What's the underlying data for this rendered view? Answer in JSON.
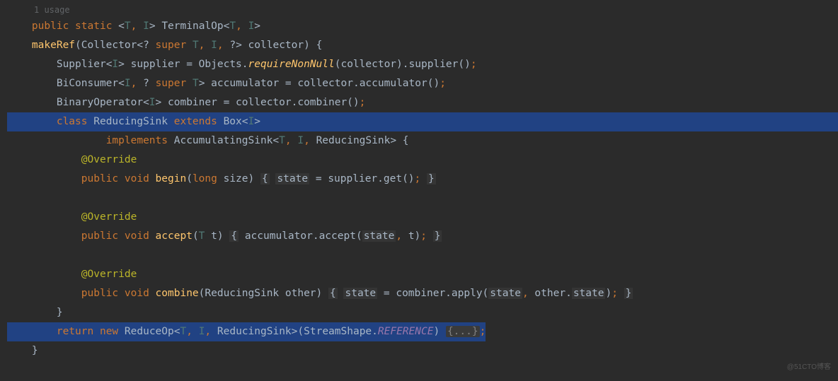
{
  "usage_hint": "1 usage",
  "code": {
    "l1": {
      "indent": "    ",
      "kw_public": "public",
      "kw_static": "static",
      "tp_open": "<",
      "tp_T": "T",
      "comma": ",",
      "tp_I": "I",
      "tp_close": ">",
      "type_TerminalOp": "TerminalOp",
      "tp_open2": "<",
      "tp_T2": "T",
      "comma2": ",",
      "tp_I2": "I",
      "tp_close2": ">"
    },
    "l2": {
      "indent": "    ",
      "fn_makeRef": "makeRef",
      "paren_open": "(",
      "type_Collector": "Collector",
      "lt": "<",
      "q1": "?",
      "kw_super": "super",
      "tp_T": "T",
      "comma1": ",",
      "tp_I": "I",
      "comma2": ",",
      "q2": "?",
      "gt": ">",
      "param_collector": "collector",
      "paren_close": ")",
      "brace": "{"
    },
    "l3": {
      "indent": "        ",
      "type_Supplier": "Supplier",
      "lt": "<",
      "tp_I": "I",
      "gt": ">",
      "var_supplier": "supplier",
      "eq": "=",
      "type_Objects": "Objects",
      "dot": ".",
      "fn_requireNonNull": "requireNonNull",
      "arg_collector": "(collector)",
      "dot2": ".",
      "fn_supplier": "supplier",
      "parens": "()",
      "semi": ";"
    },
    "l4": {
      "indent": "        ",
      "type_BiConsumer": "BiConsumer",
      "lt": "<",
      "tp_I": "I",
      "comma1": ",",
      "q": "?",
      "kw_super": "super",
      "tp_T": "T",
      "gt": ">",
      "var_accumulator": "accumulator",
      "eq": "=",
      "expr": "collector.accumulator()",
      "semi": ";"
    },
    "l5": {
      "indent": "        ",
      "type_BinaryOperator": "BinaryOperator",
      "lt": "<",
      "tp_I": "I",
      "gt": ">",
      "var_combiner": "combiner",
      "eq": "=",
      "expr": "collector.combiner()",
      "semi": ";"
    },
    "l6": {
      "indent": "        ",
      "kw_class": "class",
      "cls_ReducingSink": "ReducingSink",
      "kw_extends": "extends",
      "cls_Box": "Box",
      "lt": "<",
      "tp_I": "I",
      "gt": ">"
    },
    "l7": {
      "indent": "                ",
      "kw_implements": "implements",
      "cls_AccSink": "AccumulatingSink",
      "lt": "<",
      "tp_T": "T",
      "comma1": ",",
      "tp_I": "I",
      "comma2": ",",
      "cls_RS": "ReducingSink",
      "gt": ">",
      "brace": "{"
    },
    "l8": {
      "indent": "            ",
      "anno": "@Override"
    },
    "l9": {
      "indent": "            ",
      "kw_public": "public",
      "kw_void": "void",
      "fn_begin": "begin",
      "params_open": "(",
      "kw_long": "long",
      "param_size": "size",
      "params_close": ")",
      "brace_open": "{",
      "var_state": "state",
      "eq": "=",
      "expr": "supplier.get()",
      "semi": ";",
      "brace_close": "}"
    },
    "l11": {
      "indent": "            ",
      "anno": "@Override"
    },
    "l12": {
      "indent": "            ",
      "kw_public": "public",
      "kw_void": "void",
      "fn_accept": "accept",
      "params_open": "(",
      "tp_T": "T",
      "param_t": "t",
      "params_close": ")",
      "brace_open": "{",
      "expr1": "accumulator.accept(",
      "var_state": "state",
      "comma": ",",
      "arg_t": "t",
      "expr2": ")",
      "semi": ";",
      "brace_close": "}"
    },
    "l14": {
      "indent": "            ",
      "anno": "@Override"
    },
    "l15": {
      "indent": "            ",
      "kw_public": "public",
      "kw_void": "void",
      "fn_combine": "combine",
      "params_open": "(",
      "type_RS": "ReducingSink",
      "param_other": "other",
      "params_close": ")",
      "brace_open": "{",
      "var_state": "state",
      "eq": "=",
      "expr1": "combiner.apply(",
      "var_state2": "state",
      "comma": ",",
      "expr2": "other.",
      "var_state3": "state",
      "expr3": ")",
      "semi": ";",
      "brace_close": "}"
    },
    "l16": {
      "indent": "        ",
      "brace": "}"
    },
    "l17": {
      "indent": "        ",
      "kw_return": "return",
      "kw_new": "new",
      "cls_ReduceOp": "ReduceOp",
      "lt": "<",
      "tp_T": "T",
      "comma1": ",",
      "tp_I": "I",
      "comma2": ",",
      "cls_RS": "ReducingSink",
      "gt": ">",
      "paren_open": "(",
      "type_StreamShape": "StreamShape",
      "dot": ".",
      "ref_REFERENCE": "REFERENCE",
      "paren_close": ")",
      "folded": "{...}",
      "semi": ";"
    },
    "l18": {
      "indent": "    ",
      "brace": "}"
    }
  },
  "watermark": "@51CTO博客"
}
